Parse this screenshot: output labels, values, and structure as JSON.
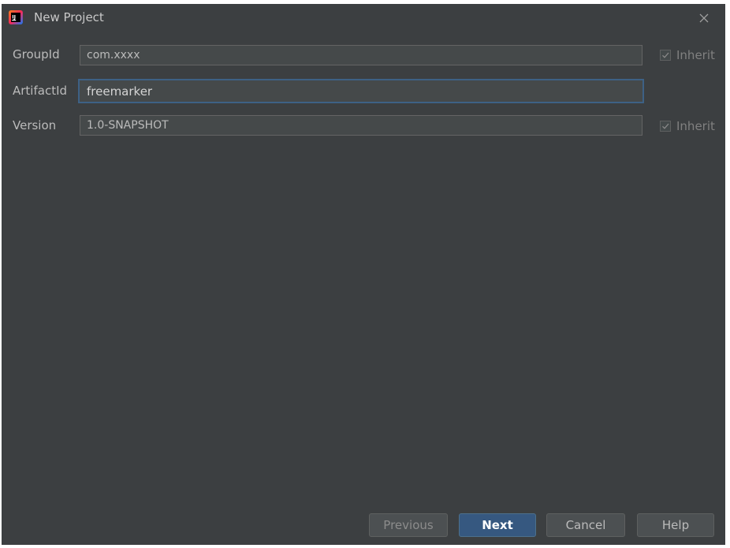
{
  "window": {
    "title": "New Project",
    "app_icon": "intellij-idea-icon",
    "close_icon": "close-icon"
  },
  "form": {
    "group_id": {
      "label": "GroupId",
      "value": "com.xxxx",
      "inherit_label": "Inherit",
      "inherit_checked": true
    },
    "artifact_id": {
      "label": "ArtifactId",
      "value": "freemarker"
    },
    "version": {
      "label": "Version",
      "value": "1.0-SNAPSHOT",
      "inherit_label": "Inherit",
      "inherit_checked": true
    }
  },
  "buttons": {
    "previous": "Previous",
    "next": "Next",
    "cancel": "Cancel",
    "help": "Help"
  },
  "colors": {
    "background": "#3c3f41",
    "field_background": "#45494a",
    "focus_border": "#3d6185",
    "primary_button": "#365880"
  }
}
